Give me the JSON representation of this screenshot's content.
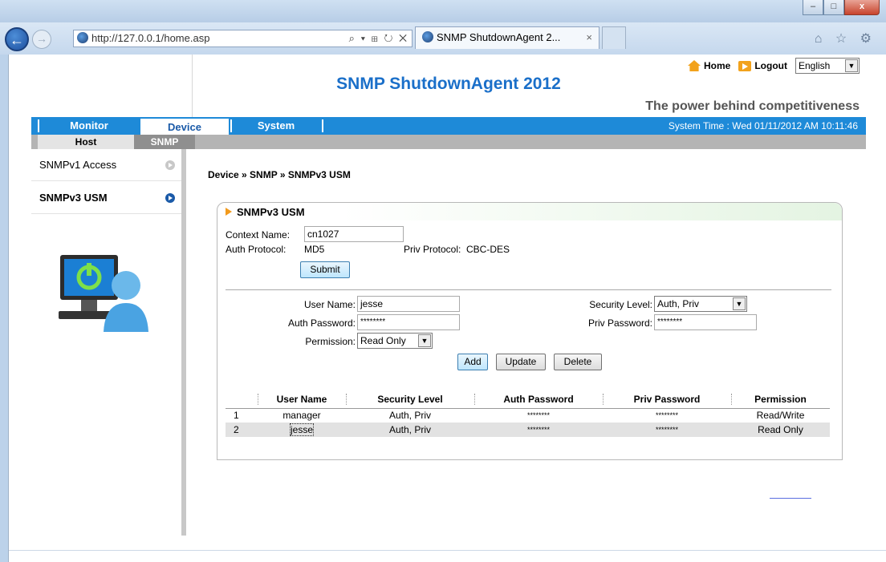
{
  "browser": {
    "url": "http://127.0.0.1/home.asp",
    "tab_title": "SNMP ShutdownAgent 2...",
    "tab_close": "×",
    "back_icon": "back-arrow-icon",
    "forward_icon": "forward-arrow-icon",
    "addr_tools": "⌕ ▾ ⊞ ↻ ✕",
    "right_tools": "⌂ ☆ ⚙",
    "window_buttons": [
      "–",
      "□",
      "x"
    ]
  },
  "header": {
    "home_label": "Home",
    "logout_label": "Logout",
    "language": "English",
    "title": "SNMP ShutdownAgent 2012",
    "tagline": "The power behind competitiveness"
  },
  "menu": {
    "items": [
      "Monitor",
      "Device",
      "System"
    ],
    "active": "Device",
    "system_time": "System Time : Wed 01/11/2012 AM 10:11:46"
  },
  "submenu": {
    "items": [
      "Host",
      "SNMP"
    ],
    "active": "SNMP"
  },
  "sidebar": {
    "items": [
      {
        "label": "SNMPv1 Access",
        "active": false
      },
      {
        "label": "SNMPv3 USM",
        "active": true
      }
    ]
  },
  "breadcrumb": "Device » SNMP » SNMPv3 USM",
  "panel": {
    "title": "SNMPv3 USM",
    "context_name_label": "Context Name:",
    "context_name_value": "cn1027",
    "auth_protocol_label": "Auth Protocol:",
    "auth_protocol_value": "MD5",
    "priv_protocol_label": "Priv Protocol:",
    "priv_protocol_value": "CBC-DES",
    "submit_label": "Submit"
  },
  "form": {
    "user_name_label": "User Name:",
    "user_name_value": "jesse",
    "auth_password_label": "Auth Password:",
    "auth_password_value": "********",
    "permission_label": "Permission:",
    "permission_value": "Read Only",
    "security_level_label": "Security Level:",
    "security_level_value": "Auth, Priv",
    "priv_password_label": "Priv Password:",
    "priv_password_value": "********",
    "add_label": "Add",
    "update_label": "Update",
    "delete_label": "Delete"
  },
  "table": {
    "columns": [
      "",
      "User Name",
      "Security Level",
      "Auth Password",
      "Priv Password",
      "Permission"
    ],
    "rows": [
      {
        "num": "1",
        "user": "manager",
        "level": "Auth, Priv",
        "auth": "********",
        "priv": "********",
        "perm": "Read/Write"
      },
      {
        "num": "2",
        "user": "jesse",
        "level": "Auth, Priv",
        "auth": "********",
        "priv": "********",
        "perm": "Read Only"
      }
    ],
    "selected_row": 2
  },
  "colors": {
    "menu_blue": "#1e8ad8",
    "title_blue": "#1a6fc9",
    "accent_orange": "#f29a1c"
  }
}
